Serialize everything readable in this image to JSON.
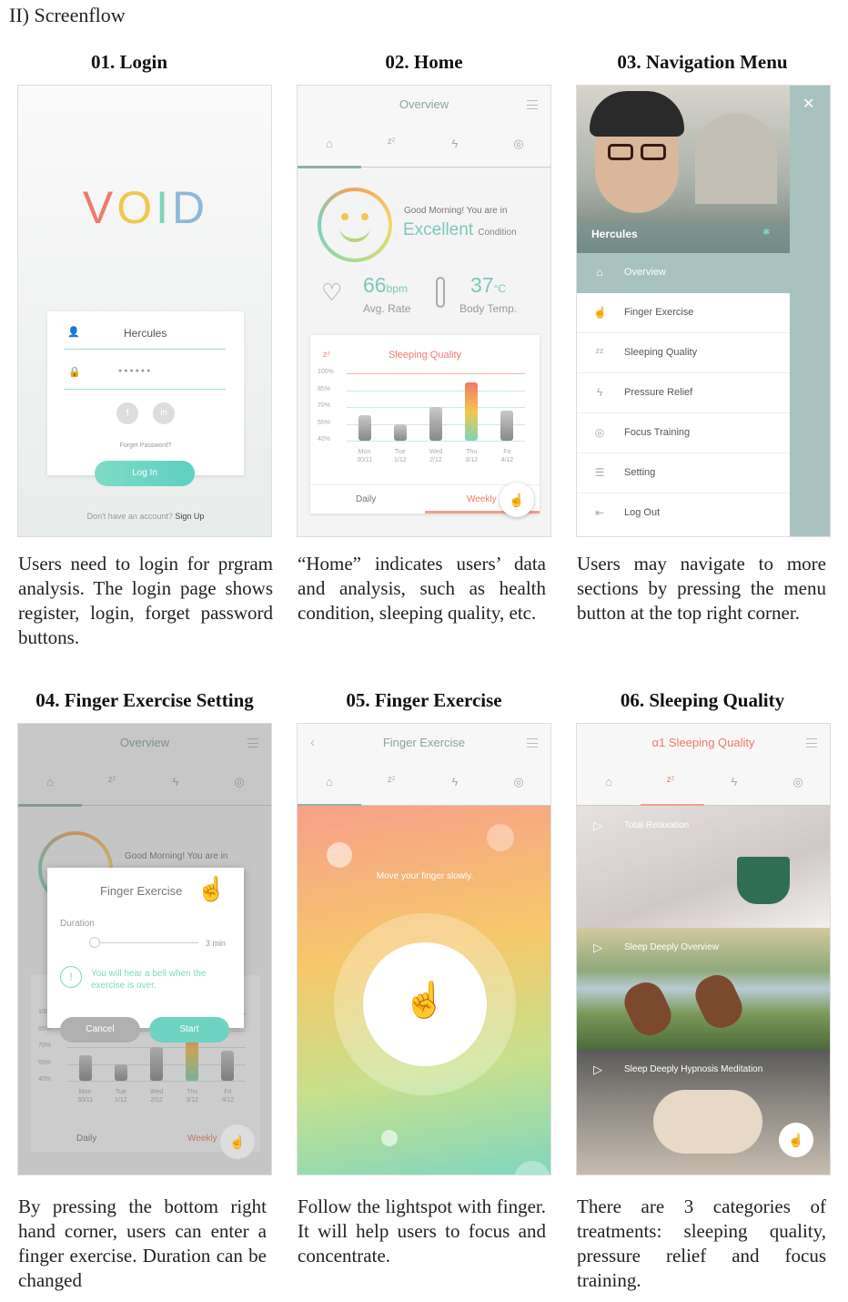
{
  "page_heading": "II) Screenflow",
  "sections": [
    {
      "title": "01. Login",
      "desc": "Users need to login for prgram analysis. The login page shows register, login, forget password buttons."
    },
    {
      "title": "02. Home",
      "desc": "“Home” indicates users’ data and analysis, such as health condition, sleeping quality, etc."
    },
    {
      "title": "03. Navigation Menu",
      "desc": "Users may navigate to more sections by pressing the menu button at the top right corner."
    },
    {
      "title": "04. Finger Exercise Setting",
      "desc": "By pressing the bottom right hand corner, users can enter a finger exercise. Duration can be changed"
    },
    {
      "title": "05. Finger Exercise",
      "desc": "Follow the lightspot with finger. It will help users to focus and concentrate."
    },
    {
      "title": "06. Sleeping Quality",
      "desc": "There are 3 categories of treatments: sleeping quality, pressure relief and focus training."
    }
  ],
  "login": {
    "logo_letters": [
      "V",
      "O",
      "I",
      "D"
    ],
    "logo_colors": [
      "#f07a6a",
      "#f3c64e",
      "#7fd4b8",
      "#8fb8d8"
    ],
    "username": "Hercules",
    "password_mask": "●●●●●●",
    "social": [
      "f",
      "in"
    ],
    "forgot": "Forget Password?",
    "login_btn": "Log In",
    "no_account": "Don't have an account?",
    "signup": "Sign Up"
  },
  "home": {
    "title": "Overview",
    "greeting": "Good Morning! You are in",
    "condition": "Excellent",
    "condition_suffix": "Condition",
    "hr_value": "66",
    "hr_unit": "bpm",
    "hr_label": "Avg. Rate",
    "temp_value": "37",
    "temp_unit": "°C",
    "temp_label": "Body Temp.",
    "chart_title": "Sleeping Quality",
    "y_ticks": [
      "100%",
      "85%",
      "70%",
      "55%",
      "40%"
    ],
    "days": [
      "Mon",
      "Tue",
      "Wed",
      "Thu",
      "Fri"
    ],
    "dates": [
      "30/11",
      "1/12",
      "2/12",
      "3/12",
      "4/12"
    ],
    "tab_daily": "Daily",
    "tab_weekly": "Weekly"
  },
  "chart_data": {
    "type": "bar",
    "title": "Sleeping Quality",
    "categories": [
      "Mon 30/11",
      "Tue 1/12",
      "Wed 2/12",
      "Thu 3/12",
      "Fri 4/12"
    ],
    "values": [
      63,
      55,
      70,
      92,
      67
    ],
    "ylim": [
      40,
      100
    ]
  },
  "nav": {
    "user": "Hercules",
    "items": [
      {
        "icon": "⌂",
        "label": "Overview"
      },
      {
        "icon": "☝",
        "label": "Finger Exercise"
      },
      {
        "icon": "zz",
        "label": "Sleeping Quality"
      },
      {
        "icon": "ϟ",
        "label": "Pressure Relief"
      },
      {
        "icon": "◎",
        "label": "Focus Training"
      },
      {
        "icon": "☰",
        "label": "Setting"
      },
      {
        "icon": "⇤",
        "label": "Log Out"
      }
    ]
  },
  "setting": {
    "dialog_title": "Finger Exercise",
    "duration_label": "Duration",
    "duration_value": "3 min",
    "info": "You will hear a bell when the exercise is over.",
    "cancel": "Cancel",
    "start": "Start"
  },
  "exercise": {
    "title": "Finger Exercise",
    "instruction": "Move your finger slowly."
  },
  "sleep": {
    "title_prefix": "α1",
    "title": "Sleeping Quality",
    "cards": [
      "Total Relaxation",
      "Sleep Deeply Overview",
      "Sleep Deeply Hypnosis Meditation"
    ]
  }
}
